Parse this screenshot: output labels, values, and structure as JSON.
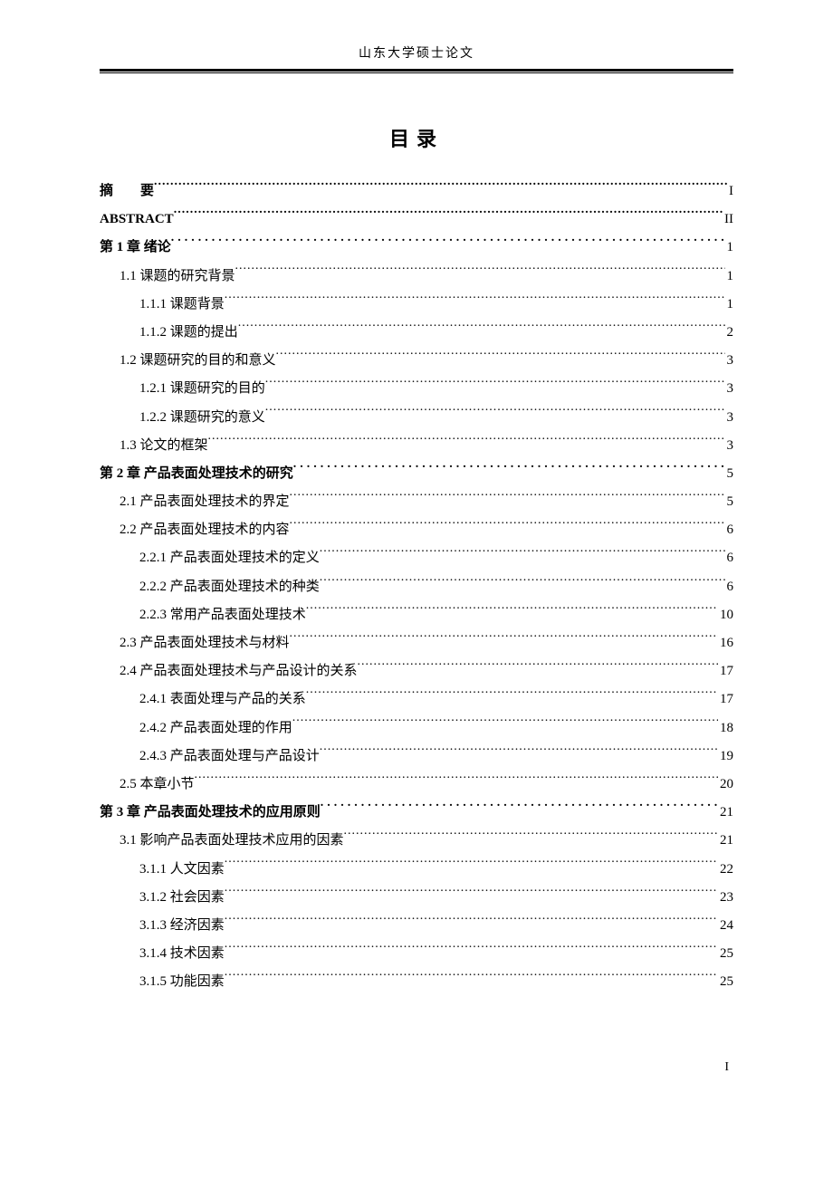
{
  "header": "山东大学硕士论文",
  "title": "目录",
  "pageNumber": "I",
  "entries": [
    {
      "indent": 0,
      "label": "摘　　要",
      "page": "I",
      "wide": false,
      "labelClass": ""
    },
    {
      "indent": 0,
      "label": "ABSTRACT",
      "page": "II",
      "wide": false,
      "labelClass": "abstract-label"
    },
    {
      "indent": 0,
      "label": "第 1 章 绪论",
      "page": "1",
      "wide": true,
      "labelClass": ""
    },
    {
      "indent": 1,
      "label": "1.1 课题的研究背景",
      "page": "1",
      "wide": false,
      "labelClass": ""
    },
    {
      "indent": 2,
      "label": "1.1.1 课题背景",
      "page": "1",
      "wide": false,
      "labelClass": ""
    },
    {
      "indent": 2,
      "label": "1.1.2 课题的提出",
      "page": "2",
      "wide": false,
      "labelClass": ""
    },
    {
      "indent": 1,
      "label": "1.2 课题研究的目的和意义",
      "page": "3",
      "wide": false,
      "labelClass": ""
    },
    {
      "indent": 2,
      "label": "1.2.1 课题研究的目的",
      "page": "3",
      "wide": false,
      "labelClass": ""
    },
    {
      "indent": 2,
      "label": "1.2.2 课题研究的意义",
      "page": "3",
      "wide": false,
      "labelClass": ""
    },
    {
      "indent": 1,
      "label": "1.3 论文的框架",
      "page": "3",
      "wide": false,
      "labelClass": ""
    },
    {
      "indent": 0,
      "label": "第 2 章 产品表面处理技术的研究",
      "page": "5",
      "wide": true,
      "labelClass": ""
    },
    {
      "indent": 1,
      "label": "2.1 产品表面处理技术的界定",
      "page": "5",
      "wide": false,
      "labelClass": ""
    },
    {
      "indent": 1,
      "label": "2.2 产品表面处理技术的内容",
      "page": "6",
      "wide": false,
      "labelClass": ""
    },
    {
      "indent": 2,
      "label": "2.2.1 产品表面处理技术的定义",
      "page": "6",
      "wide": false,
      "labelClass": ""
    },
    {
      "indent": 2,
      "label": "2.2.2 产品表面处理技术的种类",
      "page": "6",
      "wide": false,
      "labelClass": ""
    },
    {
      "indent": 2,
      "label": "2.2.3 常用产品表面处理技术",
      "page": "10",
      "wide": false,
      "labelClass": ""
    },
    {
      "indent": 1,
      "label": "2.3 产品表面处理技术与材料",
      "page": "16",
      "wide": false,
      "labelClass": ""
    },
    {
      "indent": 1,
      "label": "2.4 产品表面处理技术与产品设计的关系",
      "page": "17",
      "wide": false,
      "labelClass": ""
    },
    {
      "indent": 2,
      "label": "2.4.1 表面处理与产品的关系",
      "page": "17",
      "wide": false,
      "labelClass": ""
    },
    {
      "indent": 2,
      "label": "2.4.2 产品表面处理的作用",
      "page": "18",
      "wide": false,
      "labelClass": ""
    },
    {
      "indent": 2,
      "label": "2.4.3 产品表面处理与产品设计",
      "page": "19",
      "wide": false,
      "labelClass": ""
    },
    {
      "indent": 1,
      "label": "2.5 本章小节",
      "page": "20",
      "wide": false,
      "labelClass": ""
    },
    {
      "indent": 0,
      "label": "第 3 章 产品表面处理技术的应用原则",
      "page": "21",
      "wide": true,
      "labelClass": ""
    },
    {
      "indent": 1,
      "label": "3.1 影响产品表面处理技术应用的因素",
      "page": "21",
      "wide": false,
      "labelClass": ""
    },
    {
      "indent": 2,
      "label": "3.1.1 人文因素",
      "page": "22",
      "wide": false,
      "labelClass": ""
    },
    {
      "indent": 2,
      "label": "3.1.2 社会因素",
      "page": "23",
      "wide": false,
      "labelClass": ""
    },
    {
      "indent": 2,
      "label": "3.1.3 经济因素",
      "page": "24",
      "wide": false,
      "labelClass": ""
    },
    {
      "indent": 2,
      "label": "3.1.4 技术因素",
      "page": "25",
      "wide": false,
      "labelClass": ""
    },
    {
      "indent": 2,
      "label": "3.1.5 功能因素",
      "page": "25",
      "wide": false,
      "labelClass": ""
    }
  ]
}
